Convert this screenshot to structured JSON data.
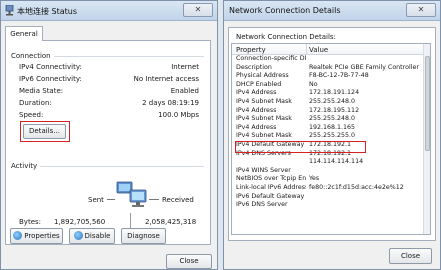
{
  "status_window": {
    "title": "本地连接 Status",
    "close_label": "✕",
    "tab_label": "General",
    "connection": {
      "section_label": "Connection",
      "rows": [
        {
          "label": "IPv4 Connectivity:",
          "value": "Internet"
        },
        {
          "label": "IPv6 Connectivity:",
          "value": "No Internet access"
        },
        {
          "label": "Media State:",
          "value": "Enabled"
        },
        {
          "label": "Duration:",
          "value": "2 days 08:19:19"
        },
        {
          "label": "Speed:",
          "value": "100.0 Mbps"
        }
      ],
      "details_button": "Details..."
    },
    "activity": {
      "section_label": "Activity",
      "sent_label": "Sent",
      "received_label": "Received",
      "bytes_label": "Bytes:",
      "bytes_sent": "1,892,705,560",
      "bytes_received": "2,058,425,318"
    },
    "buttons": {
      "properties": "Properties",
      "disable": "Disable",
      "diagnose": "Diagnose",
      "close": "Close"
    }
  },
  "details_window": {
    "title": "Network Connection Details",
    "close_label": "✕",
    "group_label": "Network Connection Details:",
    "columns": {
      "property": "Property",
      "value": "Value"
    },
    "rows": [
      {
        "property": "Connection-specific DN...",
        "value": ""
      },
      {
        "property": "Description",
        "value": "Realtek PCIe GBE Family Controller"
      },
      {
        "property": "Physical Address",
        "value": "F8-BC-12-7B-77-48"
      },
      {
        "property": "DHCP Enabled",
        "value": "No"
      },
      {
        "property": "IPv4 Address",
        "value": "172.18.191.124"
      },
      {
        "property": "IPv4 Subnet Mask",
        "value": "255.255.248.0"
      },
      {
        "property": "IPv4 Address",
        "value": "172.18.195.112"
      },
      {
        "property": "IPv4 Subnet Mask",
        "value": "255.255.248.0"
      },
      {
        "property": "IPv4 Address",
        "value": "192.168.1.165"
      },
      {
        "property": "IPv4 Subnet Mask",
        "value": "255.255.255.0"
      },
      {
        "property": "IPv4 Default Gateway",
        "value": "172.18.192.1"
      },
      {
        "property": "IPv4 DNS Servers",
        "value": "172.18.192.1"
      },
      {
        "property": "",
        "value": "114.114.114.114"
      },
      {
        "property": "IPv4 WINS Server",
        "value": ""
      },
      {
        "property": "NetBIOS over Tcpip En...",
        "value": "Yes"
      },
      {
        "property": "Link-local IPv6 Address",
        "value": "fe80::2c1f:d15d:acc:4e2e%12"
      },
      {
        "property": "IPv6 Default Gateway",
        "value": ""
      },
      {
        "property": "IPv6 DNS Server",
        "value": ""
      }
    ],
    "close_button": "Close"
  }
}
